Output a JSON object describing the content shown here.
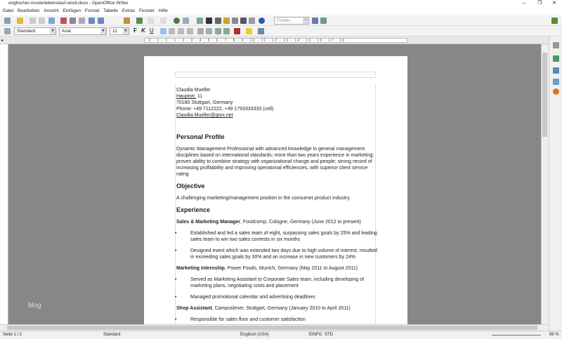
{
  "window": {
    "title": "englischer-musterlebenslauf-word.docx - OpenOffice Writer",
    "minimize": "–",
    "restore": "❐",
    "close": "✕"
  },
  "menu": [
    "Datei",
    "Bearbeiten",
    "Ansicht",
    "Einfügen",
    "Format",
    "Tabelle",
    "Extras",
    "Fenster",
    "Hilfe"
  ],
  "toolbar": {
    "find_placeholder": "Finden",
    "style": "Standard",
    "font": "Arial",
    "size": "11",
    "bold": "F",
    "italic": "K",
    "underline": "U"
  },
  "ruler": "· 2 · 1 · 1 · 1 · 2 · 3 · 4 · 5 · 6 · 7 · 8 · 9 · 10 · 11 · 12 · 13 · 14 · 15 · 16 · 17 · 18",
  "document": {
    "name": "Claudia Mueller",
    "street": "Hauptstr.",
    "street_no": " 11",
    "city": "70180 Stuttgart, Germany",
    "phone": "Phone: +49 7112222, +49 1793333333 (cell)",
    "email": "Claudia.Mueller@gmx.net",
    "h_profile": "Personal Profile",
    "profile": "Dynamic Management Professional with advanced knowledge in general management disciplines based on international standards; more than two years experience in marketing; proven ability to combine strategy with organizational change and people; strong record of increasing profitability and improving operational efficiencies, with superior client service rating",
    "h_objective": "Objective",
    "objective": "A challenging marketing/management position in the consumer product industry",
    "h_experience": "Experience",
    "jobs": [
      {
        "title": "Sales & Marketing Manager",
        "rest": ", Foodcomp, Cologne, Germany (June 2012 to present)",
        "bullets": [
          "Established and led a sales team of eight, surpassing sales goals by 25% and leading sales team to win two sales contests in six months",
          "Designed event which was extended two days due to high volume of interest, resulted in exceeding sales goals by 30% and an increase in new customers by 24%"
        ]
      },
      {
        "title": "Marketing Internship",
        "rest": ", Power Foods, Munich, Germany (May 2011 to August 2011)",
        "bullets": [
          "Served as Marketing Assistant to Corporate Sales team, including developing of marketing plans, negotiating costs and placement",
          "Managed promotional calendar and advertising deadlines"
        ]
      },
      {
        "title": "Shop Assistant",
        "rest": ", Campuslever, Stuttgart, Germany (January 2010 to April 2011)",
        "bullets": [
          "Responsible for sales floor and customer satisfaction"
        ]
      }
    ]
  },
  "watermark": "blog",
  "status": {
    "page": "Seite 1 / 2",
    "style": "Standard",
    "language": "Englisch (USA)",
    "insert": "EINFG",
    "mode": "STD",
    "zoom": "99 %"
  }
}
